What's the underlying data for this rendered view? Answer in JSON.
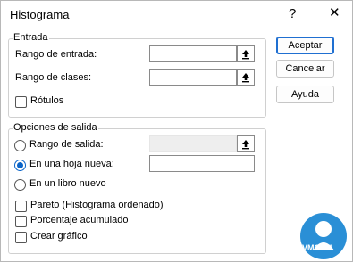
{
  "dialog": {
    "title": "Histograma",
    "help_glyph": "?",
    "close_glyph": "✕"
  },
  "entrada": {
    "group_title": "Entrada",
    "input_range_label": "Rango de entrada:",
    "input_range_value": "",
    "bin_range_label": "Rango de clases:",
    "bin_range_value": "",
    "labels_checkbox": "Rótulos",
    "labels_checked": false
  },
  "salida": {
    "group_title": "Opciones de salida",
    "output_range_label": "Rango de salida:",
    "output_range_value": "",
    "new_sheet_label": "En una hoja nueva:",
    "new_sheet_value": "",
    "new_book_label": "En un libro nuevo",
    "selected_option": "new_sheet",
    "pareto_label": "Pareto (Histograma ordenado)",
    "pareto_checked": false,
    "cumulative_label": "Porcentaje acumulado",
    "cumulative_checked": false,
    "chart_label": "Crear gráfico",
    "chart_checked": false
  },
  "buttons": {
    "ok": "Aceptar",
    "cancel": "Cancelar",
    "help": "Ayuda"
  },
  "watermark": {
    "text": "VMOLTL",
    "colors": {
      "bg": "#2a8fd6",
      "fg": "#ffffff"
    }
  }
}
